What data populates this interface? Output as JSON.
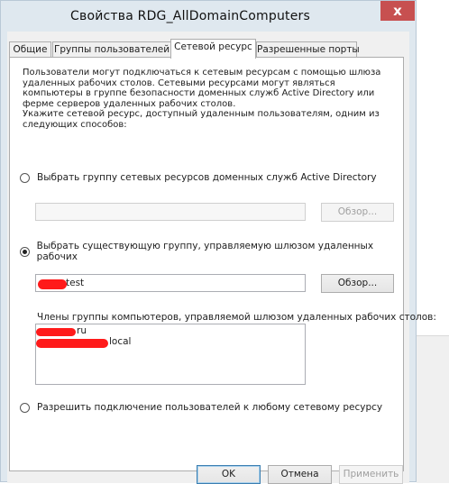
{
  "window": {
    "title": "Свойства RDG_AllDomainComputers",
    "close_glyph": "x"
  },
  "tabs": [
    "Общие",
    "Группы пользователей",
    "Сетевой ресурс",
    "Разрешенные порты"
  ],
  "active_tab_index": 2,
  "description": "Пользователи могут подключаться к сетевым ресурсам с помощью шлюза удаленных рабочих столов. Сетевыми ресурсами могут являться компьютеры в группе безопасности доменных служб Active Directory или ферме серверов удаленных рабочих столов.\nУкажите сетевой ресурс, доступный удаленным пользователям, одним из следующих способов:",
  "option_ad_group": {
    "label": "Выбрать группу сетевых ресурсов доменных служб Active Directory",
    "checked": false,
    "value": "",
    "browse_label": "Обзор...",
    "enabled": false
  },
  "option_existing_group": {
    "label": "Выбрать существующую группу, управляемую шлюзом удаленных рабочих",
    "checked": true,
    "value": "test",
    "browse_label": "Обзор...",
    "enabled": true
  },
  "members": {
    "label": "Члены группы компьютеров, управляемой шлюзом удаленных рабочих столов:",
    "items": [
      "ru",
      "local"
    ]
  },
  "option_any_resource": {
    "label": "Разрешить подключение пользователей к любому сетевому ресурсу",
    "checked": false
  },
  "footer": {
    "ok": "OK",
    "cancel": "Отмена",
    "apply": "Применить"
  },
  "colors": {
    "redaction": "#ff1a1a",
    "close": "#c75050",
    "frame": "#dfe8ef"
  }
}
